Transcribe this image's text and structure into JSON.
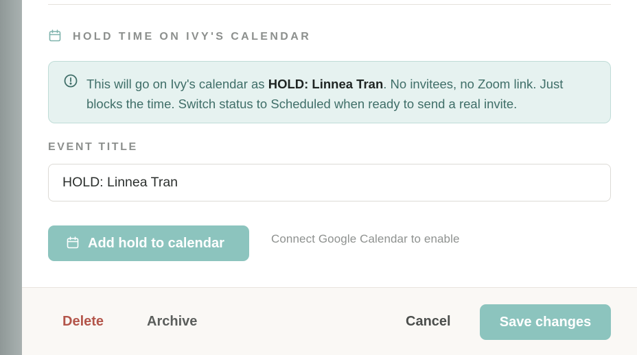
{
  "section": {
    "title": "HOLD TIME ON IVY'S CALENDAR",
    "icon": "calendar-icon",
    "icon_color": "#7fb3ad"
  },
  "info": {
    "icon": "info-circle-icon",
    "prefix": "This will go on Ivy's calendar as ",
    "bold_text": "HOLD: Linnea Tran",
    "suffix": ". No invitees, no Zoom link. Just blocks the time. Switch status to Scheduled when ready to send a real invite."
  },
  "event_title": {
    "label": "EVENT TITLE",
    "value": "HOLD: Linnea Tran"
  },
  "add_hold": {
    "label": "Add hold to calendar",
    "icon": "calendar-icon",
    "hint": "Connect Google Calendar to enable"
  },
  "footer": {
    "delete_label": "Delete",
    "archive_label": "Archive",
    "cancel_label": "Cancel",
    "save_label": "Save changes"
  },
  "colors": {
    "accent": "#8cc4be",
    "danger": "#b3554a",
    "info_bg": "#e6f2f0"
  }
}
